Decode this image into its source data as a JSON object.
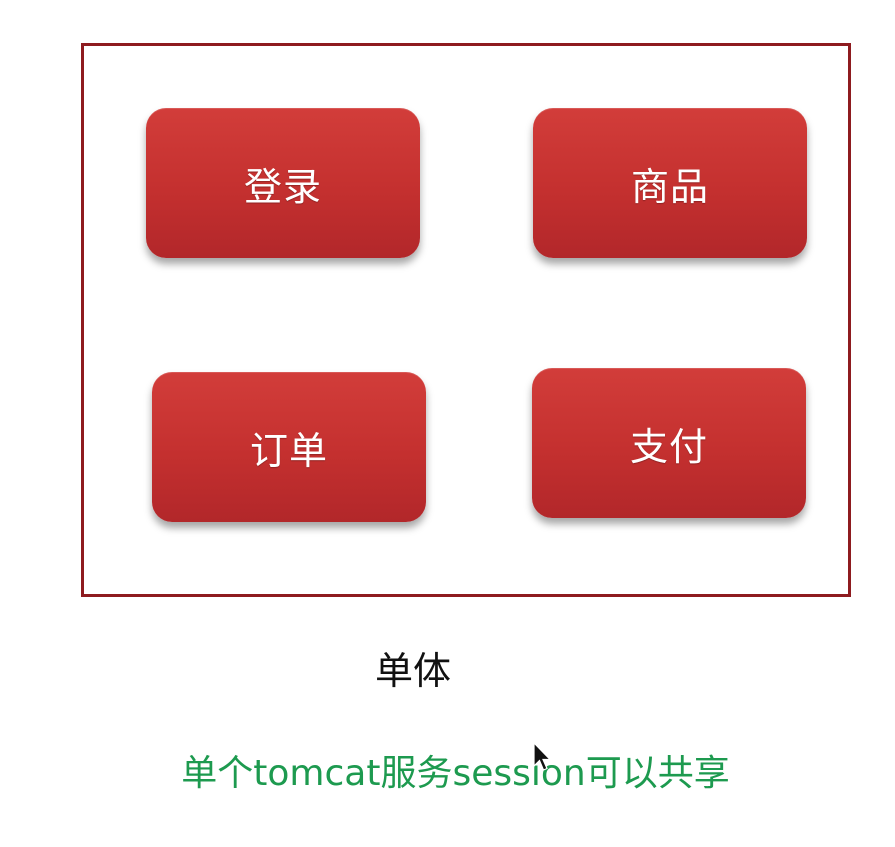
{
  "diagram": {
    "modules": [
      {
        "label": "登录"
      },
      {
        "label": "商品"
      },
      {
        "label": "订单"
      },
      {
        "label": "支付"
      }
    ],
    "caption": "单体",
    "note": "单个tomcat服务session可以共享"
  },
  "colors": {
    "frame_border": "#8e1b1f",
    "module_fill": "#c4302f",
    "module_text": "#ffffff",
    "caption_text": "#111111",
    "note_text": "#1d9a4f"
  },
  "icons": {
    "cursor": "mouse-pointer-icon"
  }
}
